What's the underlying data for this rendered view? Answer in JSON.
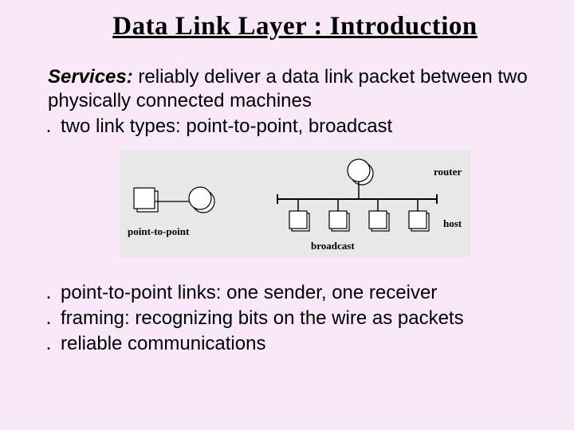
{
  "title": "Data Link Layer : Introduction",
  "intro_label": "Services:",
  "intro_text": " reliably deliver a data link packet between two physically connected machines",
  "bullets_top": [
    "two link types: point-to-point, broadcast"
  ],
  "figure": {
    "label_p2p": "point-to-point",
    "label_router": "router",
    "label_host": "host",
    "label_broadcast": "broadcast"
  },
  "bullets_bottom": [
    "point-to-point links: one sender, one receiver",
    "framing: recognizing bits on the wire as packets",
    "reliable communications"
  ],
  "bullet_glyph": "."
}
